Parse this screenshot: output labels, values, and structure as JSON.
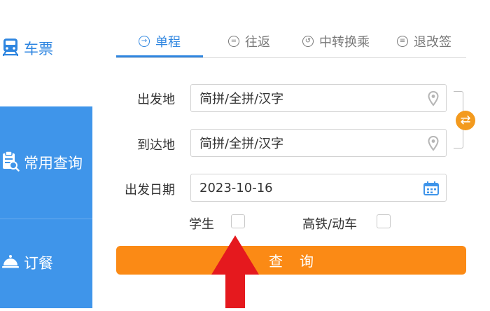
{
  "sidebar": {
    "items": [
      {
        "label": "车票",
        "icon": "train-icon"
      },
      {
        "label": "常用查询",
        "icon": "clipboard-search-icon"
      },
      {
        "label": "订餐",
        "icon": "food-cover-icon"
      }
    ]
  },
  "tabs": [
    {
      "label": "单程",
      "icon": "arrow-right-circle-icon",
      "active": true
    },
    {
      "label": "往返",
      "icon": "round-trip-icon",
      "active": false
    },
    {
      "label": "中转换乘",
      "icon": "transfer-icon",
      "active": false
    },
    {
      "label": "退改签",
      "icon": "refund-change-icon",
      "active": false
    }
  ],
  "form": {
    "from": {
      "label": "出发地",
      "value": "简拼/全拼/汉字"
    },
    "to": {
      "label": "到达地",
      "value": "简拼/全拼/汉字"
    },
    "date": {
      "label": "出发日期",
      "value": "2023-10-16"
    },
    "student": {
      "label": "学生",
      "checked": false
    },
    "highspeed": {
      "label": "高铁/动车",
      "checked": false
    },
    "search_label": "查询"
  },
  "colors": {
    "brand_blue": "#3f95ea",
    "active_blue": "#2f86e0",
    "search_orange": "#fb8a15",
    "swap_orange": "#f39a1e",
    "annotation_red": "#e5191e"
  }
}
